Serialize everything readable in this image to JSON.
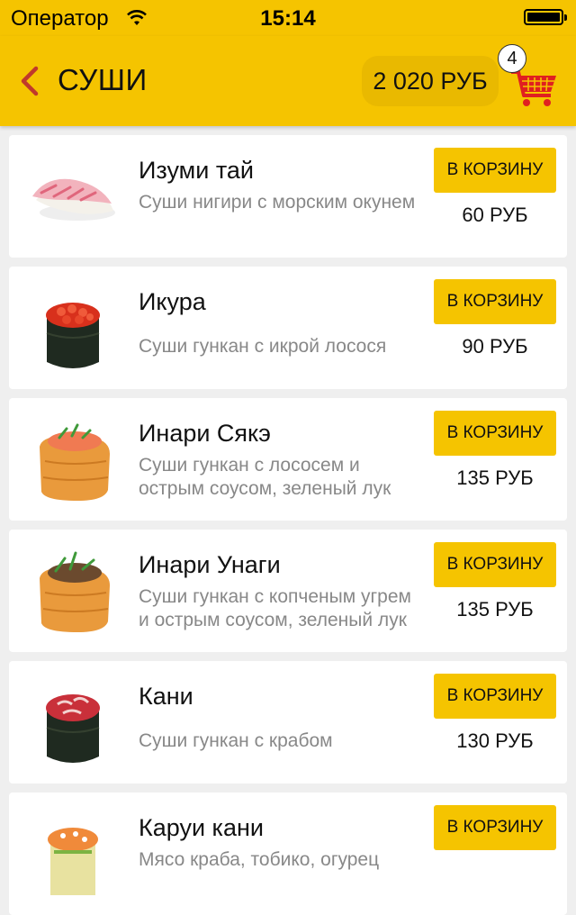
{
  "status_bar": {
    "carrier": "Оператор",
    "time": "15:14"
  },
  "nav": {
    "title": "СУШИ",
    "cart_total": "2 020 РУБ",
    "cart_count": "4",
    "colors": {
      "accent": "#f5c400",
      "cart_icon": "#e02020"
    }
  },
  "items": [
    {
      "name": "Изуми тай",
      "description": "Суши нигири с морским окунем",
      "button": "В КОРЗИНУ",
      "price": "60 РУБ"
    },
    {
      "name": "Икура",
      "description": "Суши гункан с икрой лосося",
      "button": "В КОРЗИНУ",
      "price": "90 РУБ"
    },
    {
      "name": "Инари Сякэ",
      "description": "Суши гункан с лососем и острым соусом, зеленый лук",
      "button": "В КОРЗИНУ",
      "price": "135 РУБ"
    },
    {
      "name": "Инари Унаги",
      "description": "Суши гункан с копченым угрем и острым соусом, зеленый лук",
      "button": "В КОРЗИНУ",
      "price": "135 РУБ"
    },
    {
      "name": "Кани",
      "description": "Суши гункан с крабом",
      "button": "В КОРЗИНУ",
      "price": "130 РУБ"
    },
    {
      "name": "Каруи кани",
      "description": "Мясо краба, тобико, огурец",
      "button": "В КОРЗИНУ",
      "price": ""
    }
  ]
}
